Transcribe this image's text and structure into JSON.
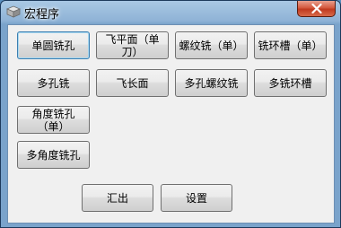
{
  "window": {
    "title": "宏程序",
    "icon": "macro-app-icon"
  },
  "buttons": {
    "single_circle_mill": "单圆铣孔",
    "face_mill_single": "飞平面（单刀）",
    "thread_mill_single": "螺纹铣（单）",
    "ring_groove_single": "铣环槽（单）",
    "multi_hole_mill": "多孔铣",
    "long_face_mill": "飞长面",
    "multi_hole_thread": "多孔螺纹铣",
    "multi_ring_groove": "多铣环槽",
    "angle_hole_single": "角度铣孔（单）",
    "multi_angle_hole": "多角度铣孔",
    "export": "汇出",
    "settings": "设置"
  },
  "colors": {
    "close": "#c03a1f",
    "client_bg": "#f0f0f0",
    "title_bar": "#8fb3d6"
  }
}
